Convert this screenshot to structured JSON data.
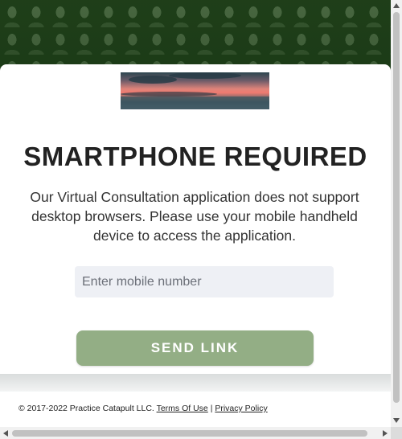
{
  "hero": {
    "image": "people-collage-green"
  },
  "logo": {
    "image": "sunset-sea-banner"
  },
  "title": "SMARTPHONE REQUIRED",
  "message": "Our Virtual Consultation application does not support desktop browsers. Please use your mobile handheld device to access the application.",
  "phone_input": {
    "placeholder": "Enter mobile number",
    "value": ""
  },
  "send_button": {
    "label": "SEND LINK",
    "color": "#93ae85"
  },
  "footer": {
    "copyright": "© 2017-2022 Practice Catapult LLC.",
    "terms_label": "Terms Of Use",
    "separator": "|",
    "privacy_label": "Privacy Policy"
  },
  "colors": {
    "hero_bg": "#1f3f19",
    "accent": "#93ae85"
  }
}
